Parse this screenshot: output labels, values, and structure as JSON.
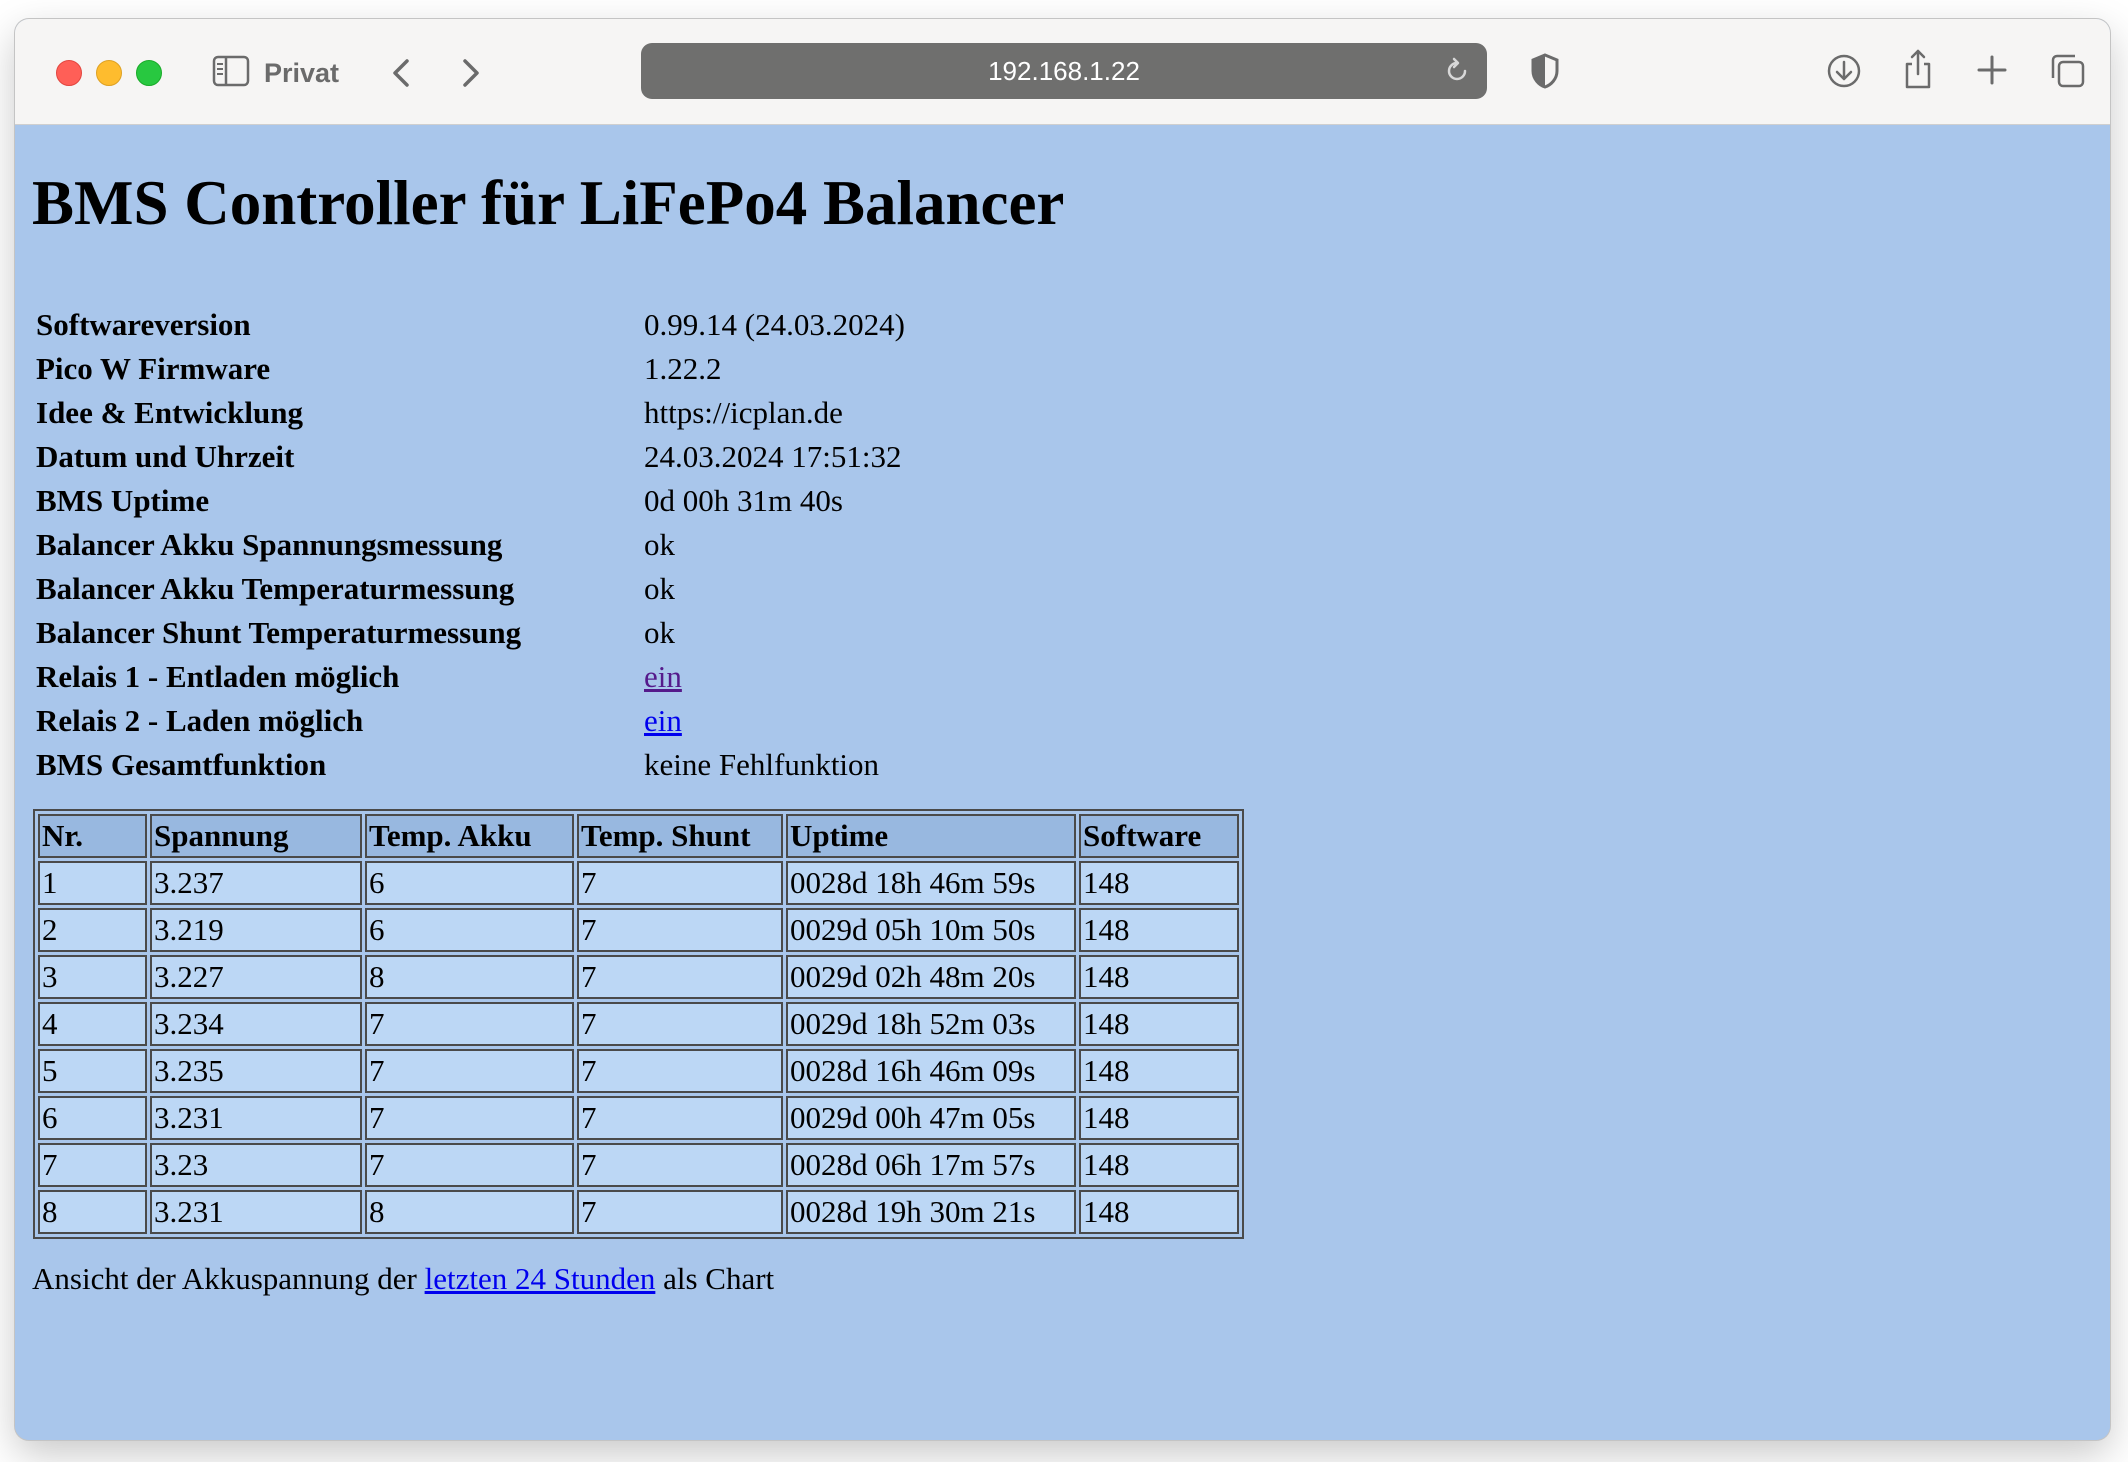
{
  "browser": {
    "profile_label": "Privat",
    "url": "192.168.1.22",
    "icons": [
      "sidebar-icon",
      "back-arrow-icon",
      "forward-arrow-icon",
      "reload-icon",
      "shield-icon",
      "download-icon",
      "share-icon",
      "new-tab-plus-icon",
      "tab-overview-icon"
    ]
  },
  "page": {
    "title": "BMS Controller für LiFePo4 Balancer",
    "info": [
      {
        "label": "Softwareversion",
        "value": "0.99.14 (24.03.2024)"
      },
      {
        "label": "Pico W Firmware",
        "value": "1.22.2"
      },
      {
        "label": "Idee & Entwicklung",
        "value": "https://icplan.de"
      },
      {
        "label": "Datum und Uhrzeit",
        "value": "24.03.2024 17:51:32"
      },
      {
        "label": "BMS Uptime",
        "value": "0d 00h 31m 40s"
      },
      {
        "label": "Balancer Akku Spannungsmessung",
        "value": "ok"
      },
      {
        "label": "Balancer Akku Temperaturmessung",
        "value": "ok"
      },
      {
        "label": "Balancer Shunt Temperaturmessung",
        "value": "ok"
      },
      {
        "label": "Relais 1 - Entladen möglich",
        "value": "ein"
      },
      {
        "label": "Relais 2 - Laden möglich",
        "value": "ein"
      },
      {
        "label": "BMS Gesamtfunktion",
        "value": "keine Fehlfunktion"
      }
    ],
    "table": {
      "headers": [
        "Nr.",
        "Spannung",
        "Temp. Akku",
        "Temp. Shunt",
        "Uptime",
        "Software"
      ],
      "rows": [
        [
          "1",
          "3.237",
          "6",
          "7",
          "0028d 18h 46m 59s",
          "148"
        ],
        [
          "2",
          "3.219",
          "6",
          "7",
          "0029d 05h 10m 50s",
          "148"
        ],
        [
          "3",
          "3.227",
          "8",
          "7",
          "0029d 02h 48m 20s",
          "148"
        ],
        [
          "4",
          "3.234",
          "7",
          "7",
          "0029d 18h 52m 03s",
          "148"
        ],
        [
          "5",
          "3.235",
          "7",
          "7",
          "0028d 16h 46m 09s",
          "148"
        ],
        [
          "6",
          "3.231",
          "7",
          "7",
          "0029d 00h 47m 05s",
          "148"
        ],
        [
          "7",
          "3.23",
          "7",
          "7",
          "0028d 06h 17m 57s",
          "148"
        ],
        [
          "8",
          "3.231",
          "8",
          "7",
          "0028d 19h 30m 21s",
          "148"
        ]
      ]
    },
    "footer": {
      "prefix": "Ansicht der Akkuspannung der ",
      "link_text": "letzten 24 Stunden",
      "suffix": " als Chart"
    }
  },
  "colors": {
    "page_background": "#a9c6eb",
    "header_cell": "#98b8e0",
    "body_cell": "#bcd7f5",
    "link": "#0000ee",
    "visited_link": "#551a8b"
  }
}
